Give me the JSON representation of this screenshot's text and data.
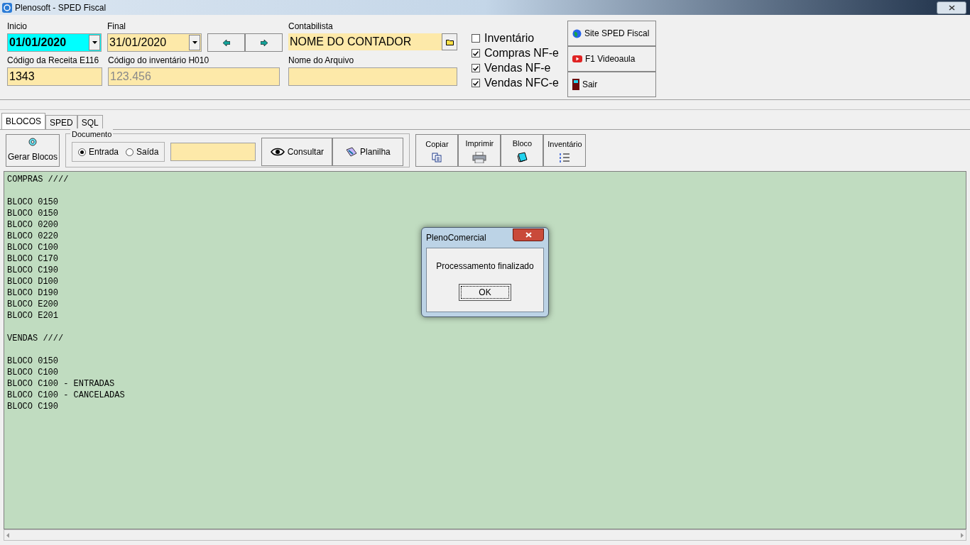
{
  "window": {
    "title": "Plenosoft - SPED Fiscal"
  },
  "form": {
    "inicio": {
      "label": "Inicio",
      "value": "01/01/2020"
    },
    "final": {
      "label": "Final",
      "value": "31/01/2020"
    },
    "contabilista": {
      "label": "Contabilista",
      "value": "NOME DO CONTADOR"
    },
    "codigo_receita": {
      "label": "Código da Receita E116",
      "value": "1343"
    },
    "codigo_inventario": {
      "label": "Código do inventário H010",
      "value": "123.456",
      "disabled": true
    },
    "nome_arquivo": {
      "label": "Nome do Arquivo"
    }
  },
  "options": [
    {
      "label": "Inventário",
      "checked": false
    },
    {
      "label": "Compras NF-e",
      "checked": true
    },
    {
      "label": "Vendas NF-e",
      "checked": true
    },
    {
      "label": "Vendas NFC-e",
      "checked": true
    }
  ],
  "side_buttons": [
    {
      "kind": "globe",
      "label": "Site SPED Fiscal"
    },
    {
      "kind": "video",
      "label": "F1 Videoaula"
    },
    {
      "kind": "door",
      "label": "Sair"
    }
  ],
  "tabs": [
    {
      "label": "BLOCOS",
      "selected": true
    },
    {
      "label": "SPED",
      "selected": false
    },
    {
      "label": "SQL",
      "selected": false
    }
  ],
  "toolbar": {
    "gerar": "Gerar Blocos",
    "documento": {
      "label": "Documento",
      "options": [
        {
          "label": "Entrada",
          "selected": true
        },
        {
          "label": "Saída",
          "selected": false
        }
      ]
    },
    "actions": [
      {
        "kind": "eye",
        "label": "Consultar"
      },
      {
        "kind": "sheet",
        "label": "Planilha"
      }
    ],
    "tools": [
      {
        "kind": "copy",
        "label": "Copiar"
      },
      {
        "kind": "print",
        "label": "Imprimir"
      },
      {
        "kind": "note",
        "label": "Bloco"
      },
      {
        "kind": "list",
        "label": "Inventário"
      }
    ]
  },
  "log": [
    {
      "heading": "COMPRAS ////",
      "lines": [
        "BLOCO 0150",
        "BLOCO 0150",
        "BLOCO 0200",
        "BLOCO 0220",
        "BLOCO C100",
        "BLOCO C170",
        "BLOCO C190",
        "BLOCO D100",
        "BLOCO D190",
        "BLOCO E200",
        "BLOCO E201"
      ]
    },
    {
      "heading": "VENDAS ////",
      "lines": [
        "BLOCO 0150",
        "BLOCO C100",
        "BLOCO C100 - ENTRADAS",
        "BLOCO C100 - CANCELADAS",
        "BLOCO C190"
      ]
    }
  ],
  "dialog": {
    "title": "PlenoComercial",
    "message": "Processamento finalizado",
    "button": "OK"
  }
}
